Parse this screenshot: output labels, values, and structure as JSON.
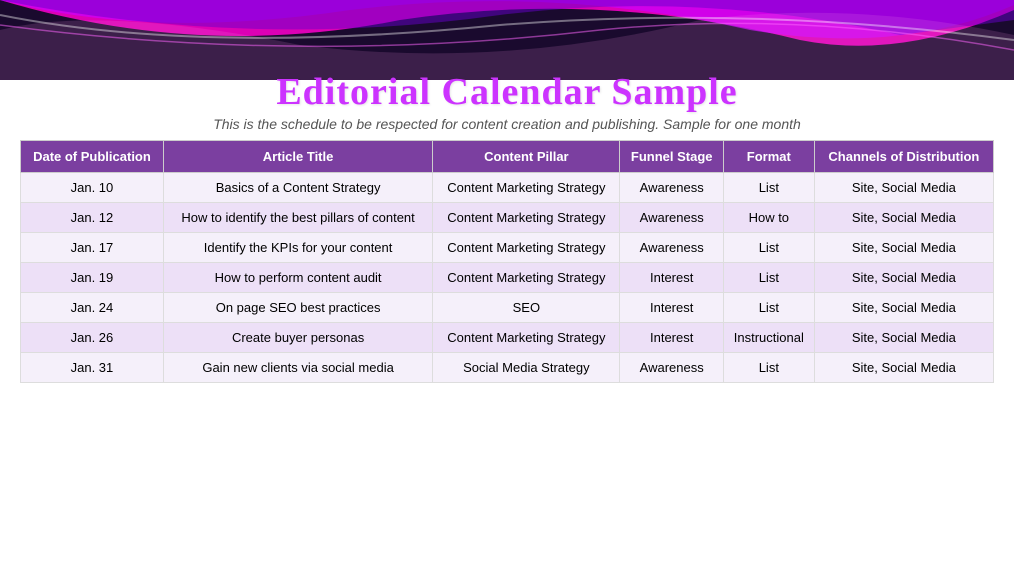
{
  "title": "Editorial Calendar Sample",
  "subtitle": "This is the schedule to be respected for content creation and publishing. Sample for one month",
  "table": {
    "headers": [
      "Date of Publication",
      "Article Title",
      "Content Pillar",
      "Funnel Stage",
      "Format",
      "Channels of Distribution"
    ],
    "rows": [
      {
        "date": "Jan. 10",
        "title": "Basics of a Content Strategy",
        "pillar": "Content Marketing Strategy",
        "funnel": "Awareness",
        "format": "List",
        "channels": "Site, Social Media"
      },
      {
        "date": "Jan. 12",
        "title": "How to identify the best pillars of content",
        "pillar": "Content Marketing Strategy",
        "funnel": "Awareness",
        "format": "How to",
        "channels": "Site, Social Media"
      },
      {
        "date": "Jan. 17",
        "title": "Identify the KPIs for your content",
        "pillar": "Content Marketing Strategy",
        "funnel": "Awareness",
        "format": "List",
        "channels": "Site, Social Media"
      },
      {
        "date": "Jan. 19",
        "title": "How to perform content audit",
        "pillar": "Content Marketing Strategy",
        "funnel": "Interest",
        "format": "List",
        "channels": "Site, Social Media"
      },
      {
        "date": "Jan. 24",
        "title": "On page SEO best practices",
        "pillar": "SEO",
        "funnel": "Interest",
        "format": "List",
        "channels": "Site, Social Media"
      },
      {
        "date": "Jan. 26",
        "title": "Create buyer personas",
        "pillar": "Content Marketing Strategy",
        "funnel": "Interest",
        "format": "Instructional",
        "channels": "Site, Social Media"
      },
      {
        "date": "Jan. 31",
        "title": "Gain new clients via social media",
        "pillar": "Social Media Strategy",
        "funnel": "Awareness",
        "format": "List",
        "channels": "Site, Social Media"
      }
    ]
  }
}
